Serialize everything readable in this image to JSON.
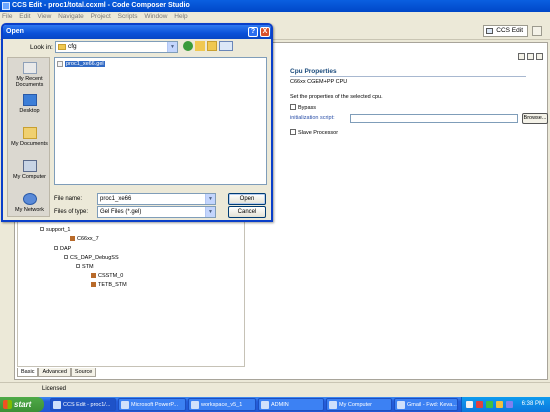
{
  "app": {
    "title": "CCS Edit - proc1/total.ccxml - Code Composer Studio",
    "menu": [
      "File",
      "Edit",
      "View",
      "Navigate",
      "Project",
      "Scripts",
      "Window",
      "Help"
    ],
    "perspective_label": "CCS Edit"
  },
  "dialog": {
    "title": "Open",
    "look_in_label": "Look in:",
    "look_in_value": "cfg",
    "places": [
      "My Recent Documents",
      "Desktop",
      "My Documents",
      "My Computer",
      "My Network"
    ],
    "files": [
      "proc1_xe66.gel"
    ],
    "file_name_label": "File name:",
    "file_name_value": "proc1_xe66",
    "file_type_label": "Files of type:",
    "file_type_value": "Gel Files (*.gel)",
    "open_label": "Open",
    "cancel_label": "Cancel",
    "help_glyph": "?",
    "close_glyph": "X"
  },
  "tree": {
    "items": [
      {
        "label": "support_1"
      },
      {
        "label": "C66xx_7"
      },
      {
        "label": "DAP"
      },
      {
        "label": "CS_DAP_DebugSS"
      },
      {
        "label": "STM"
      },
      {
        "label": "CSSTM_0"
      },
      {
        "label": "TETB_STM"
      }
    ]
  },
  "editor_tabs": [
    "Basic",
    "Advanced",
    "Source"
  ],
  "cpu_panel": {
    "title": "Cpu Properties",
    "subtitle": "C66xx CGEM+PP CPU",
    "description": "Set the properties of the selected cpu.",
    "bypass_label": "Bypass",
    "init_script_label": "initialization script:",
    "init_script_value": "",
    "browse_label": "Browse...",
    "slave_label": "Slave Processor"
  },
  "status": {
    "text": "Licensed"
  },
  "taskbar": {
    "start_label": "start",
    "tasks": [
      "CCS Edit - proc1/...",
      "Microsoft PowerP...",
      "workspace_v5_1",
      "ADMIN",
      "My Computer",
      "Gmail - Fwd: Keva..."
    ],
    "clock": "6:38 PM"
  }
}
